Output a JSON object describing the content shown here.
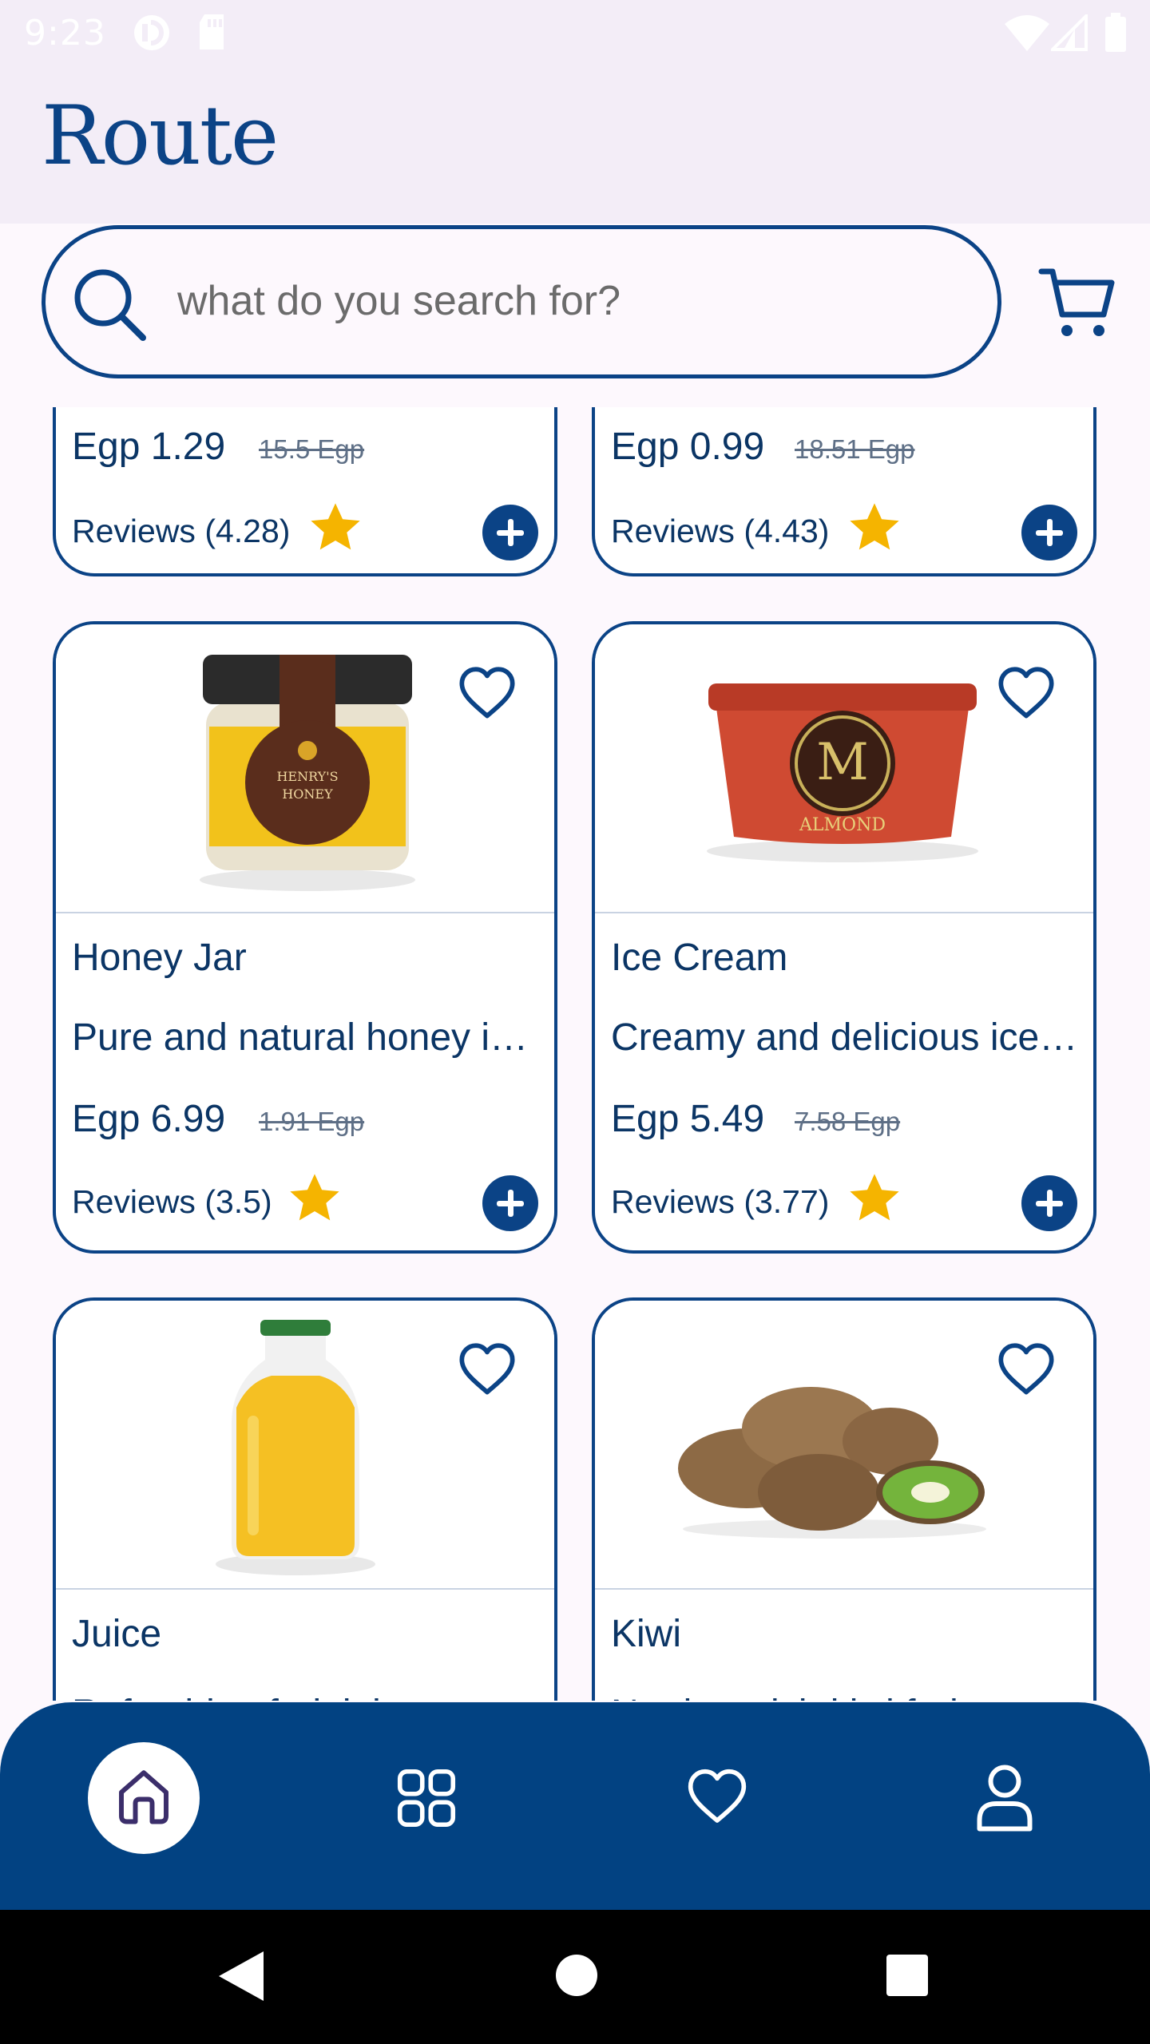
{
  "status_bar": {
    "time": "9:23"
  },
  "app": {
    "logo": "Route"
  },
  "search": {
    "placeholder": "what do you search for?"
  },
  "colors": {
    "primary": "#0b4386",
    "star": "#f5b400",
    "nav_bg": "#024282"
  },
  "products": [
    {
      "title": "",
      "description": "",
      "price": "Egp 1.29",
      "old_price": "15.5 Egp",
      "reviews": "Reviews (4.28)",
      "image": "partially-hidden"
    },
    {
      "title": "",
      "description": "",
      "price": "Egp 0.99",
      "old_price": "18.51 Egp",
      "reviews": "Reviews (4.43)",
      "image": "partially-hidden"
    },
    {
      "title": "Honey Jar",
      "description": "Pure and natural honey in a jar",
      "price": "Egp 6.99",
      "old_price": "1.91 Egp",
      "reviews": "Reviews (3.5)",
      "image": "honey-jar"
    },
    {
      "title": "Ice Cream",
      "description": "Creamy and delicious ice cream",
      "price": "Egp 5.49",
      "old_price": "7.58 Egp",
      "reviews": "Reviews (3.77)",
      "image": "ice-cream-tub"
    },
    {
      "title": "Juice",
      "description": "Refreshing fruit juice",
      "image": "juice-bottle"
    },
    {
      "title": "Kiwi",
      "description": "Nutrient-rich kiwi fruit",
      "image": "kiwi-fruit"
    }
  ],
  "bottom_nav": [
    "home-icon",
    "grid-icon",
    "heart-icon",
    "person-icon"
  ]
}
